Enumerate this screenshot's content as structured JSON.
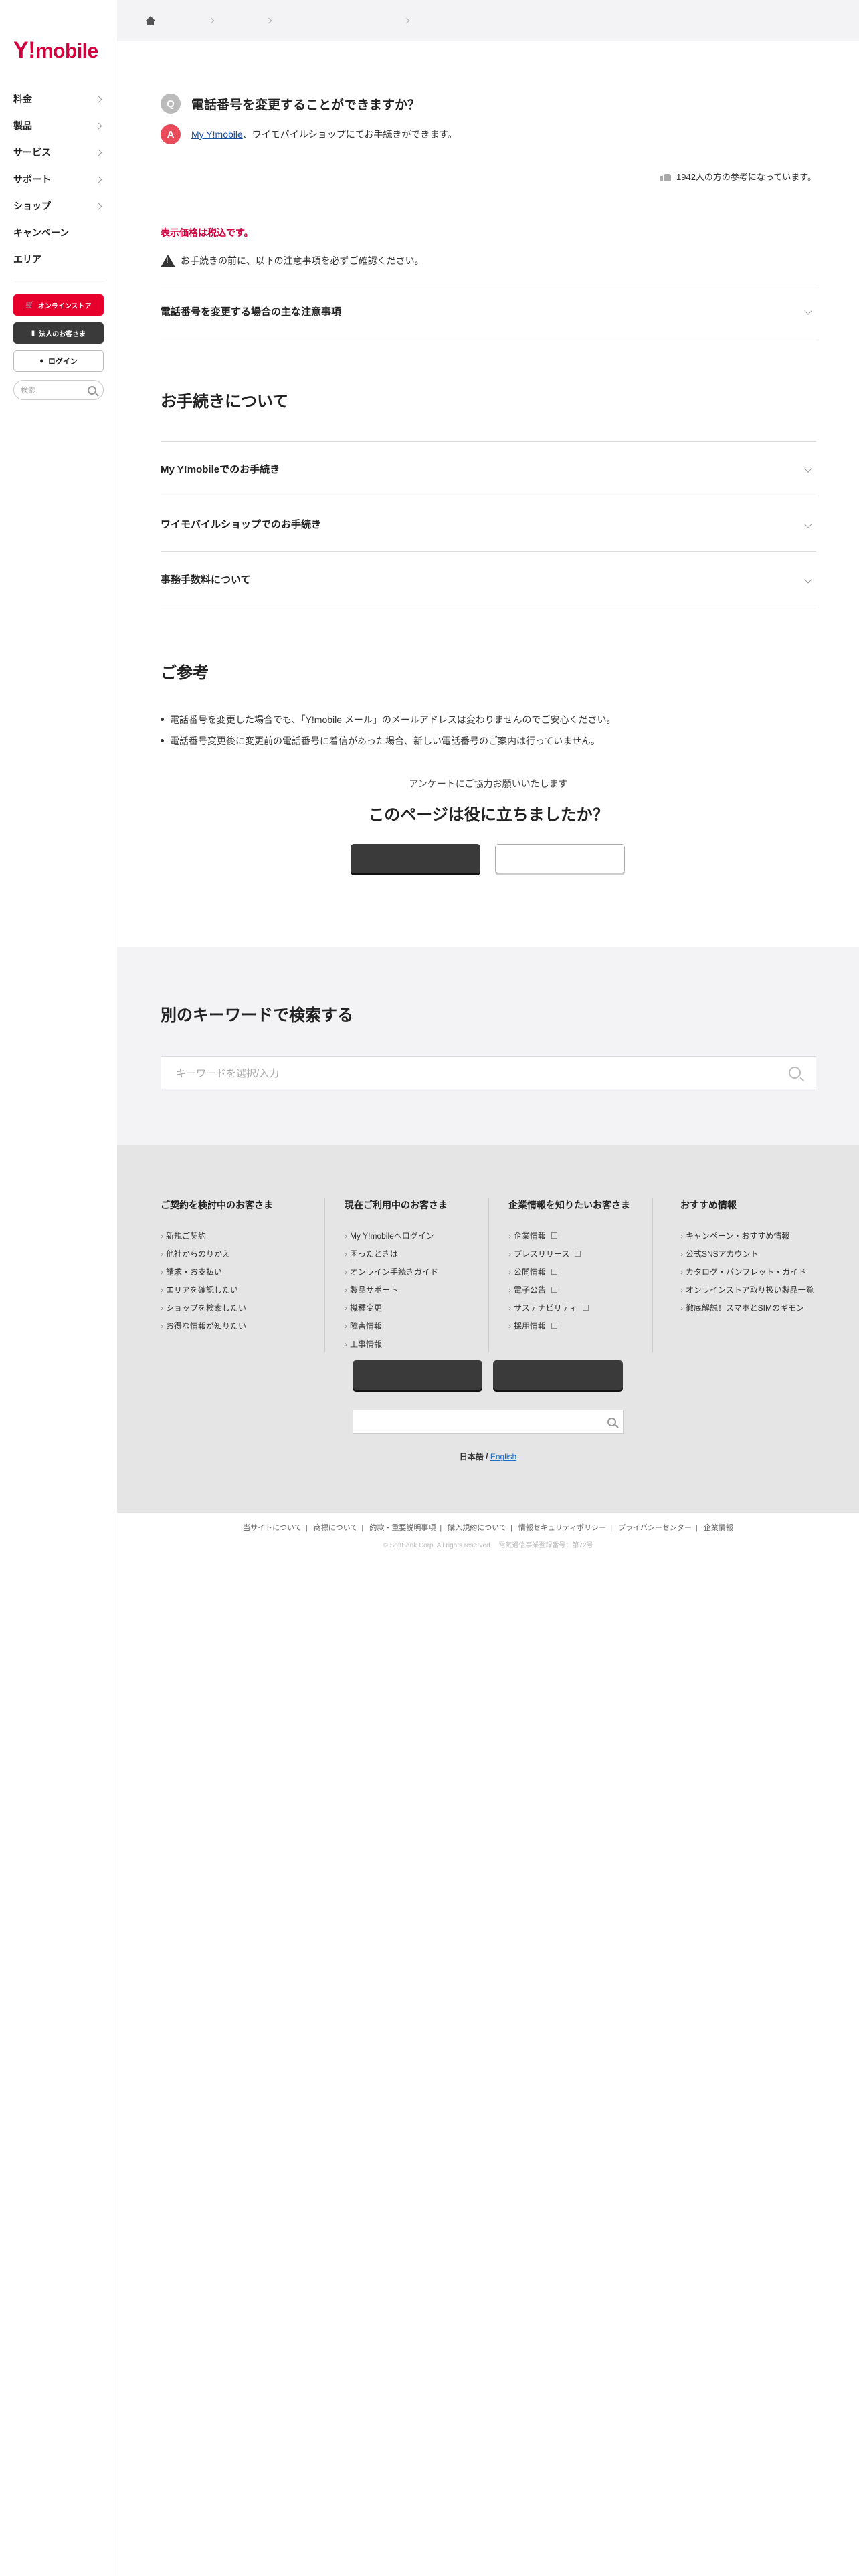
{
  "sidebar": {
    "logo_y": "Y!",
    "logo_text": "mobile",
    "nav": [
      {
        "label": "料金"
      },
      {
        "label": "製品"
      },
      {
        "label": "サービス"
      },
      {
        "label": "サポート"
      },
      {
        "label": "ショップ"
      },
      {
        "label": "キャンペーン"
      },
      {
        "label": "エリア"
      }
    ],
    "online_store": "オンラインストア",
    "corporate": "法人のお客さま",
    "login": "ログイン",
    "search_placeholder": "検索"
  },
  "faq": {
    "question": "電話番号を変更することができますか？",
    "q_badge": "Q",
    "a_badge": "A",
    "answer_link": "My Y!mobile",
    "answer_text": "、ワイモバイルショップにてお手続きができます。",
    "helpful": "1942人の方の参考になっています。"
  },
  "notes": {
    "tax": "表示価格は税込です。",
    "warning": "お手続きの前に、以下の注意事項を必ずご確認ください。"
  },
  "accordions_top": [
    {
      "label": "電話番号を変更する場合の主な注意事項"
    }
  ],
  "procedure": {
    "title": "お手続きについて",
    "items": [
      {
        "label": "My Y!mobileでのお手続き"
      },
      {
        "label": "ワイモバイルショップでのお手続き"
      },
      {
        "label": "事務手数料について"
      }
    ]
  },
  "reference": {
    "title": "ご参考",
    "bullets": [
      "電話番号を変更した場合でも、「Y!mobile メール」のメールアドレスは変わりませんのでご安心ください。",
      "電話番号変更後に変更前の電話番号に着信があった場合、新しい電話番号のご案内は行っていません。"
    ]
  },
  "survey": {
    "sub": "アンケートにご協力お願いいたします",
    "question": "このページは役に立ちましたか？"
  },
  "keyword_search": {
    "title": "別のキーワードで検索する",
    "placeholder": "キーワードを選択/入力"
  },
  "footer": {
    "columns": [
      {
        "title": "ご契約を検討中のお客さま",
        "links": [
          "新規ご契約",
          "他社からのりかえ",
          "請求・お支払い",
          "エリアを確認したい",
          "ショップを検索したい",
          "お得な情報が知りたい"
        ]
      },
      {
        "title": "現在ご利用中のお客さま",
        "links": [
          "My Y!mobileへログイン",
          "困ったときは",
          "オンライン手続きガイド",
          "製品サポート",
          "機種変更",
          "障害情報",
          "工事情報"
        ]
      },
      {
        "title": "企業情報を知りたいお客さま",
        "links": [
          "企業情報",
          "プレスリリース",
          "公開情報",
          "電子公告",
          "サステナビリティ",
          "採用情報"
        ]
      },
      {
        "title": "おすすめ情報",
        "links": [
          "キャンペーン・おすすめ情報",
          "公式SNSアカウント",
          "カタログ・パンフレット・ガイド",
          "オンラインストア取り扱い製品一覧",
          "徹底解説！スマホとSIMのギモン"
        ]
      }
    ],
    "lang_ja": "日本語",
    "lang_sep": " / ",
    "lang_en": "English"
  },
  "bottom_links": [
    "当サイトについて",
    "商標について",
    "約款・重要説明事項",
    "購入規約について",
    "情報セキュリティポリシー",
    "プライバシーセンター",
    "企業情報"
  ],
  "copyright": "© SoftBank Corp. All rights reserved.　電気通信事業登録番号：第72号"
}
